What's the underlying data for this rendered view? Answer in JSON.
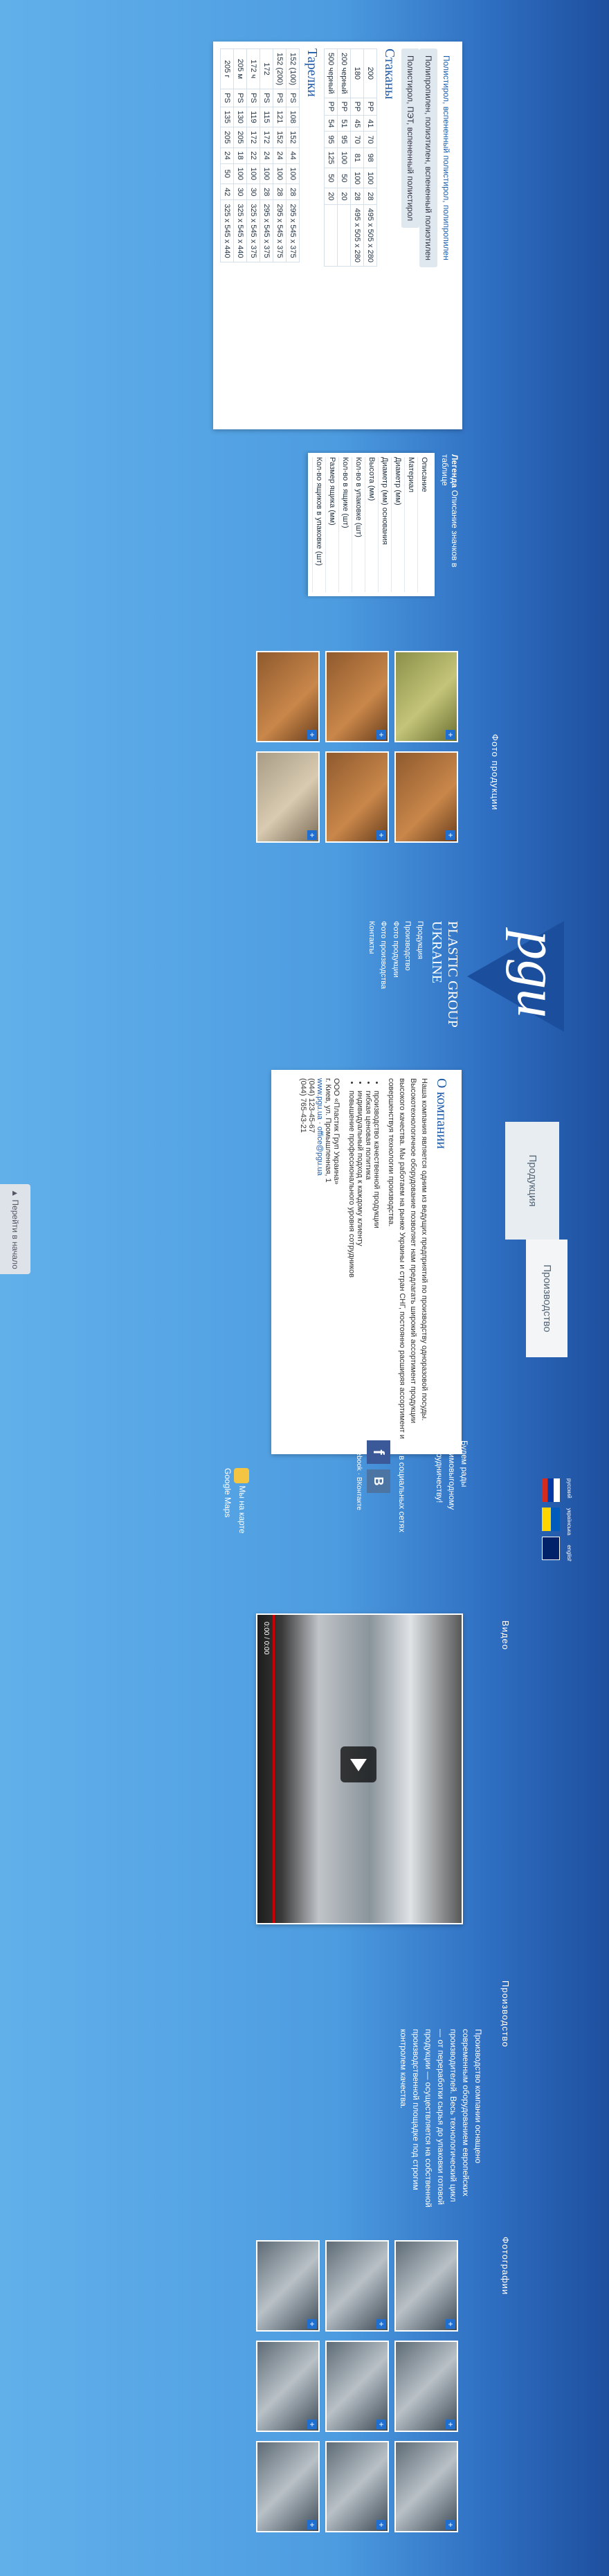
{
  "header_tabs": [
    {
      "label": "Продукция"
    },
    {
      "label": "Производство"
    }
  ],
  "languages": [
    "русский",
    "українська",
    "english"
  ],
  "products": {
    "tabs": [
      {
        "label": "Полистирол, вспененный полистирол, полипропилен"
      },
      {
        "label": "Полипропилен, полиэтилен, вспененный полиэтилен"
      },
      {
        "label": "Полистирол, ПЭТ, вспененный полистирол"
      }
    ],
    "cups_title": "Стаканы",
    "plates_title": "Тарелки",
    "legend_title": "Легенда",
    "legend_subtitle": "Описание значков в таблице",
    "legend_items": [
      "Описание",
      "Материал",
      "Диаметр (мм)",
      "Диаметр (мм) основания",
      "Высота (мм)",
      "Кол-во в упаковке (шт)",
      "Кол-во в ящике (шт)",
      "Размер ящика (мм)",
      "Кол-во ящиков в упаковке (шт)"
    ],
    "cups_header": [
      "",
      "",
      "",
      "",
      "",
      "",
      ""
    ],
    "cups_rows": [
      [
        "200",
        "PP",
        "41",
        "70",
        "98",
        "100",
        "28",
        "495 x 505 x 280"
      ],
      [
        "180",
        "PP",
        "45",
        "70",
        "81",
        "100",
        "28",
        "495 x 505 x 280"
      ],
      [
        "200 черный",
        "PP",
        "51",
        "95",
        "100",
        "50",
        "20",
        ""
      ],
      [
        "500 черный",
        "PP",
        "54",
        "95",
        "125",
        "50",
        "20",
        ""
      ]
    ],
    "plates_rows": [
      [
        "152 (100)",
        "PS",
        "108",
        "152",
        "44",
        "100",
        "28",
        "295 x 545 x 375"
      ],
      [
        "152 (200)",
        "PS",
        "121",
        "152",
        "24",
        "100",
        "28",
        "295 x 545 x 375"
      ],
      [
        "172",
        "PS",
        "115",
        "172",
        "24",
        "100",
        "28",
        "295 x 545 x 375"
      ],
      [
        "172 ч",
        "PS",
        "119",
        "172",
        "22",
        "100",
        "30",
        "325 x 545 x 375"
      ],
      [
        "205 м",
        "PS",
        "130",
        "205",
        "18",
        "100",
        "30",
        "325 x 545 x 440"
      ],
      [
        "205 г",
        "PS",
        "135",
        "205",
        "24",
        "50",
        "42",
        "325 x 545 x 440"
      ]
    ]
  },
  "photo_products_title": "Фото продукции",
  "brand": {
    "logo_text": "pgu",
    "name": "PLASTIC GROUP UKRAINE",
    "menu": [
      "Продукция",
      "Производство",
      "Фото продукции",
      "Фото производства",
      "Контакты"
    ]
  },
  "about": {
    "title": "О компании",
    "text": "Наша компания является одним из ведущих предприятий по производству одноразовой посуды. Высокотехнологичное оборудование позволяет нам предлагать широкий ассортимент продукции высокого качества. Мы работаем на рынке Украины и стран СНГ, постоянно расширяя ассортимент и совершенствуя технологии производства.",
    "bullets": [
      "производство качественной продукции",
      "гибкая ценовая политика",
      "индивидуальный подход к каждому клиенту",
      "повышение профессионального уровня сотрудников"
    ],
    "company": "ООО «Пластик Груп Украина»",
    "address": "г. Киев, ул. Промышленная, 1",
    "site": "www.pgu.ua",
    "email": "office@pgu.ua",
    "phones": [
      "(044) 123-45-67",
      "(044) 765-43-21"
    ]
  },
  "social": {
    "title": "Мы в социальных сетях",
    "items": [
      "Facebook",
      "ВКонтакте"
    ],
    "partners_title": "Будем рады взаимовыгодному сотрудничеству!",
    "map_label": "Мы на карте Google Maps"
  },
  "video": {
    "title": "Видео",
    "time": "0:00 / 0:00"
  },
  "production": {
    "title": "Производство",
    "text": "Производство компании оснащено современным оборудованием европейских производителей. Весь технологический цикл — от переработки сырья до упаковки готовой продукции — осуществляется на собственной производственной площадке под строгим контролем качества."
  },
  "photo_production_title": "Фотографии",
  "back_to_top": "Перейти в начало",
  "colors": {
    "accent": "#1e5ba8",
    "plus": "#1f6fd1"
  }
}
